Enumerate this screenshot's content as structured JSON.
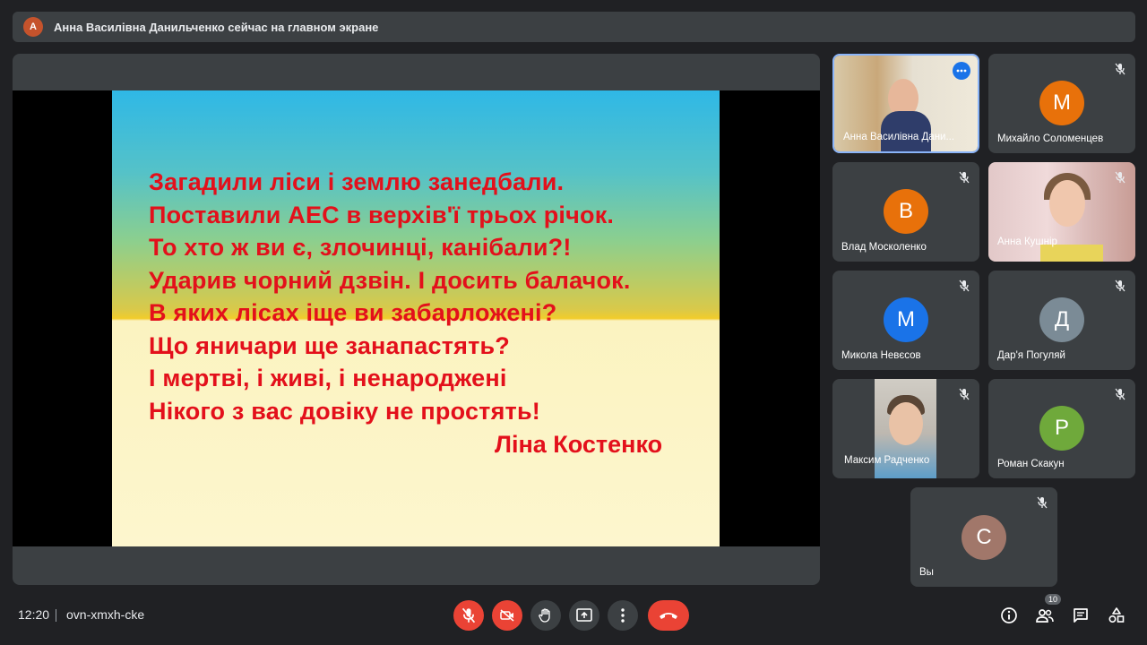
{
  "banner": {
    "avatar_letter": "А",
    "text": "Анна Василівна Данильченко сейчас на главном экране"
  },
  "slide": {
    "lines": [
      "Загадили ліси і землю занедбали.",
      "Поставили АЕС в верхів'ї трьох річок.",
      "То хто ж ви є, злочинці, канібали?!",
      "Ударив чорний дзвін. І досить балачок.",
      "В яких лісах іще ви забарложені?",
      "Що яничари ще занапастять?",
      "І мертві, і живі, і ненароджені",
      "Нікого з вас довіку не простять!"
    ],
    "author": "Ліна Костенко",
    "text_color": "#e3101b"
  },
  "participants": [
    {
      "name": "Анна Василівна Дани...",
      "type": "video",
      "active": true
    },
    {
      "name": "Михайло Соломенцев",
      "letter": "М",
      "color": "#e8710a",
      "muted": true
    },
    {
      "name": "Влад Москоленко",
      "letter": "В",
      "color": "#e8710a",
      "muted": true
    },
    {
      "name": "Анна Кушнір",
      "type": "video",
      "muted": true
    },
    {
      "name": "Микола Невєсов",
      "letter": "М",
      "color": "#1a73e8",
      "muted": true
    },
    {
      "name": "Дар'я Погуляй",
      "letter": "Д",
      "color": "#7b8b96",
      "muted": true
    },
    {
      "name": "Максим Радченко",
      "type": "video",
      "muted": true
    },
    {
      "name": "Роман Скакун",
      "letter": "Р",
      "color": "#6fa93b",
      "muted": true
    },
    {
      "name": "Вы",
      "letter": "С",
      "color": "#a1776a",
      "muted": true
    }
  ],
  "bottom": {
    "time": "12:20",
    "meeting_code": "ovn-xmxh-cke",
    "participant_count": "10"
  }
}
